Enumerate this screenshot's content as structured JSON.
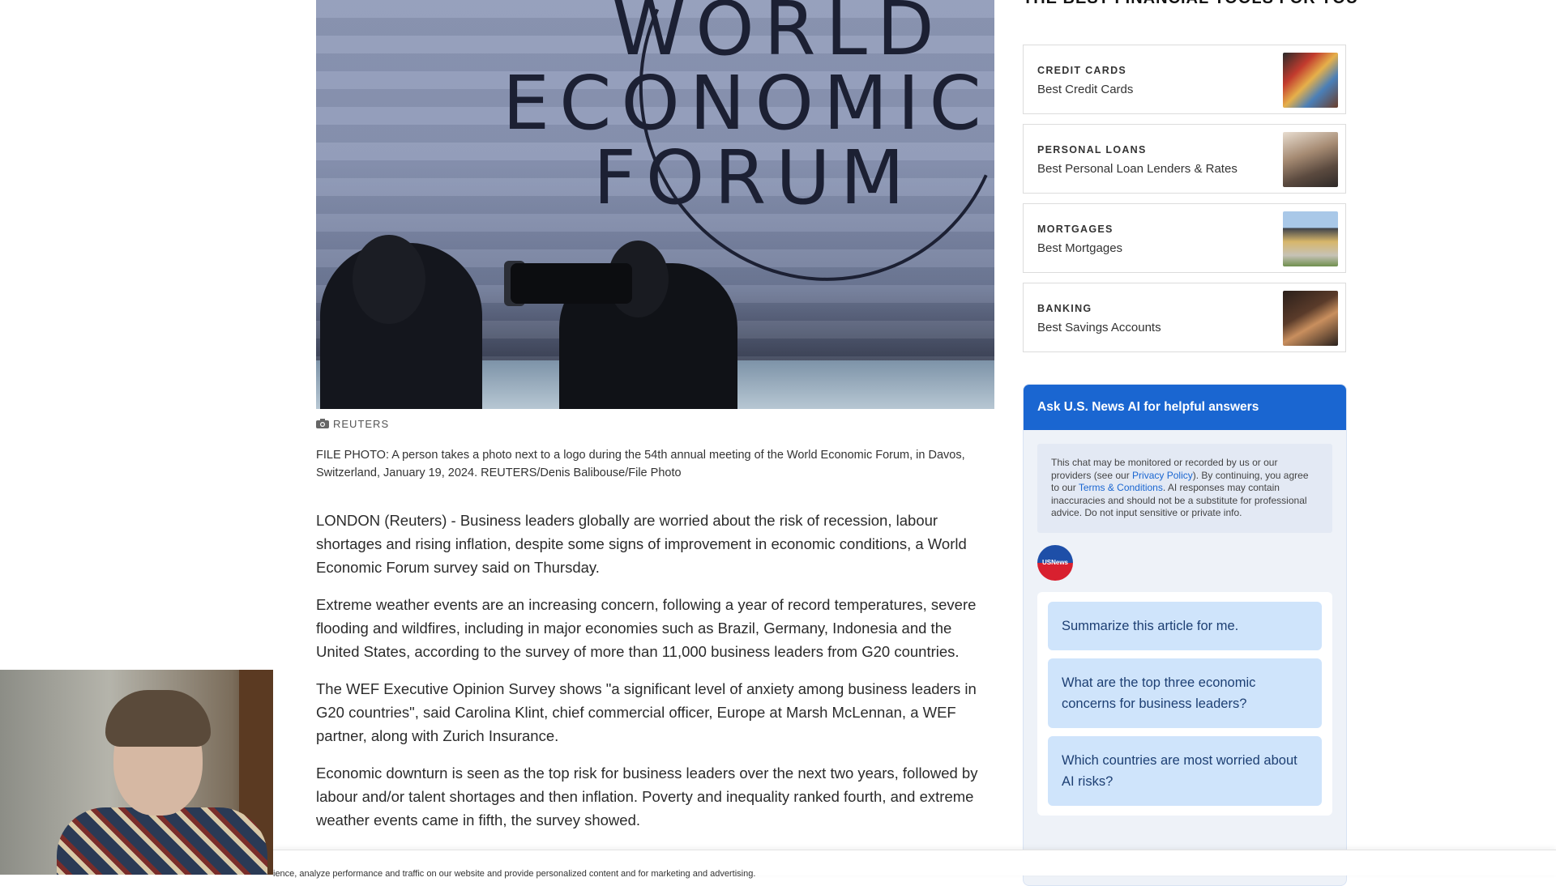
{
  "hero": {
    "logo_line1": "WORLD",
    "logo_line2": "ECONOMIC",
    "logo_line3": "FORUM",
    "credit": "REUTERS",
    "caption": "FILE PHOTO: A person takes a photo next to a logo during the 54th annual meeting of the World Economic Forum, in Davos, Switzerland, January 19, 2024. REUTERS/Denis Balibouse/File Photo"
  },
  "article": {
    "paragraphs": [
      "LONDON (Reuters) - Business leaders globally are worried about the risk of recession, labour shortages and rising inflation, despite some signs of improvement in economic conditions, a World Economic Forum survey said on Thursday.",
      "Extreme weather events are an increasing concern, following a year of record temperatures, severe flooding and wildfires, including in major economies such as Brazil, Germany, Indonesia and the United States, according to the survey of more than 11,000 business leaders from G20 countries.",
      "The WEF Executive Opinion Survey shows \"a significant level of anxiety among business leaders in G20 countries\", said Carolina Klint, chief commercial officer, Europe at Marsh McLennan, a WEF partner, along with Zurich Insurance.",
      "Economic downturn is seen as the top risk for business leaders over the next two years, followed by labour and/or talent shortages and then inflation. Poverty and inequality ranked fourth, and extreme weather events came in fifth, the survey showed."
    ]
  },
  "sidebar": {
    "heading": "THE BEST FINANCIAL TOOLS FOR YOU",
    "tools": [
      {
        "category": "CREDIT CARDS",
        "title": "Best Credit Cards",
        "thumb_color": "#c23b2e"
      },
      {
        "category": "PERSONAL LOANS",
        "title": "Best Personal Loan Lenders & Rates",
        "thumb_color": "#6d5a4b"
      },
      {
        "category": "MORTGAGES",
        "title": "Best Mortgages",
        "thumb_color": "#b89a55"
      },
      {
        "category": "BANKING",
        "title": "Best Savings Accounts",
        "thumb_color": "#3a2a22"
      }
    ]
  },
  "ai": {
    "header": "Ask U.S. News AI for helpful answers",
    "disclaimer_part1": "This chat may be monitored or recorded by us or our providers (see our ",
    "privacy_link": "Privacy Policy",
    "disclaimer_part2": "). By continuing, you agree to our ",
    "terms_link": "Terms & Conditions",
    "disclaimer_part3": ". AI responses may contain inaccuracies and should not be a substitute for professional advice. Do not input sensitive or private info.",
    "avatar_label": "USNews",
    "suggestions": [
      "Summarize this article for me.",
      "What are the top three economic concerns for business leaders?",
      "Which countries are most worried about AI risks?"
    ]
  },
  "cookie": {
    "text": "ience, analyze performance and traffic on our website and provide personalized content and for marketing and advertising."
  },
  "colors": {
    "accent_blue": "#1a66d1",
    "suggestion_bg": "#cfe4fb"
  }
}
